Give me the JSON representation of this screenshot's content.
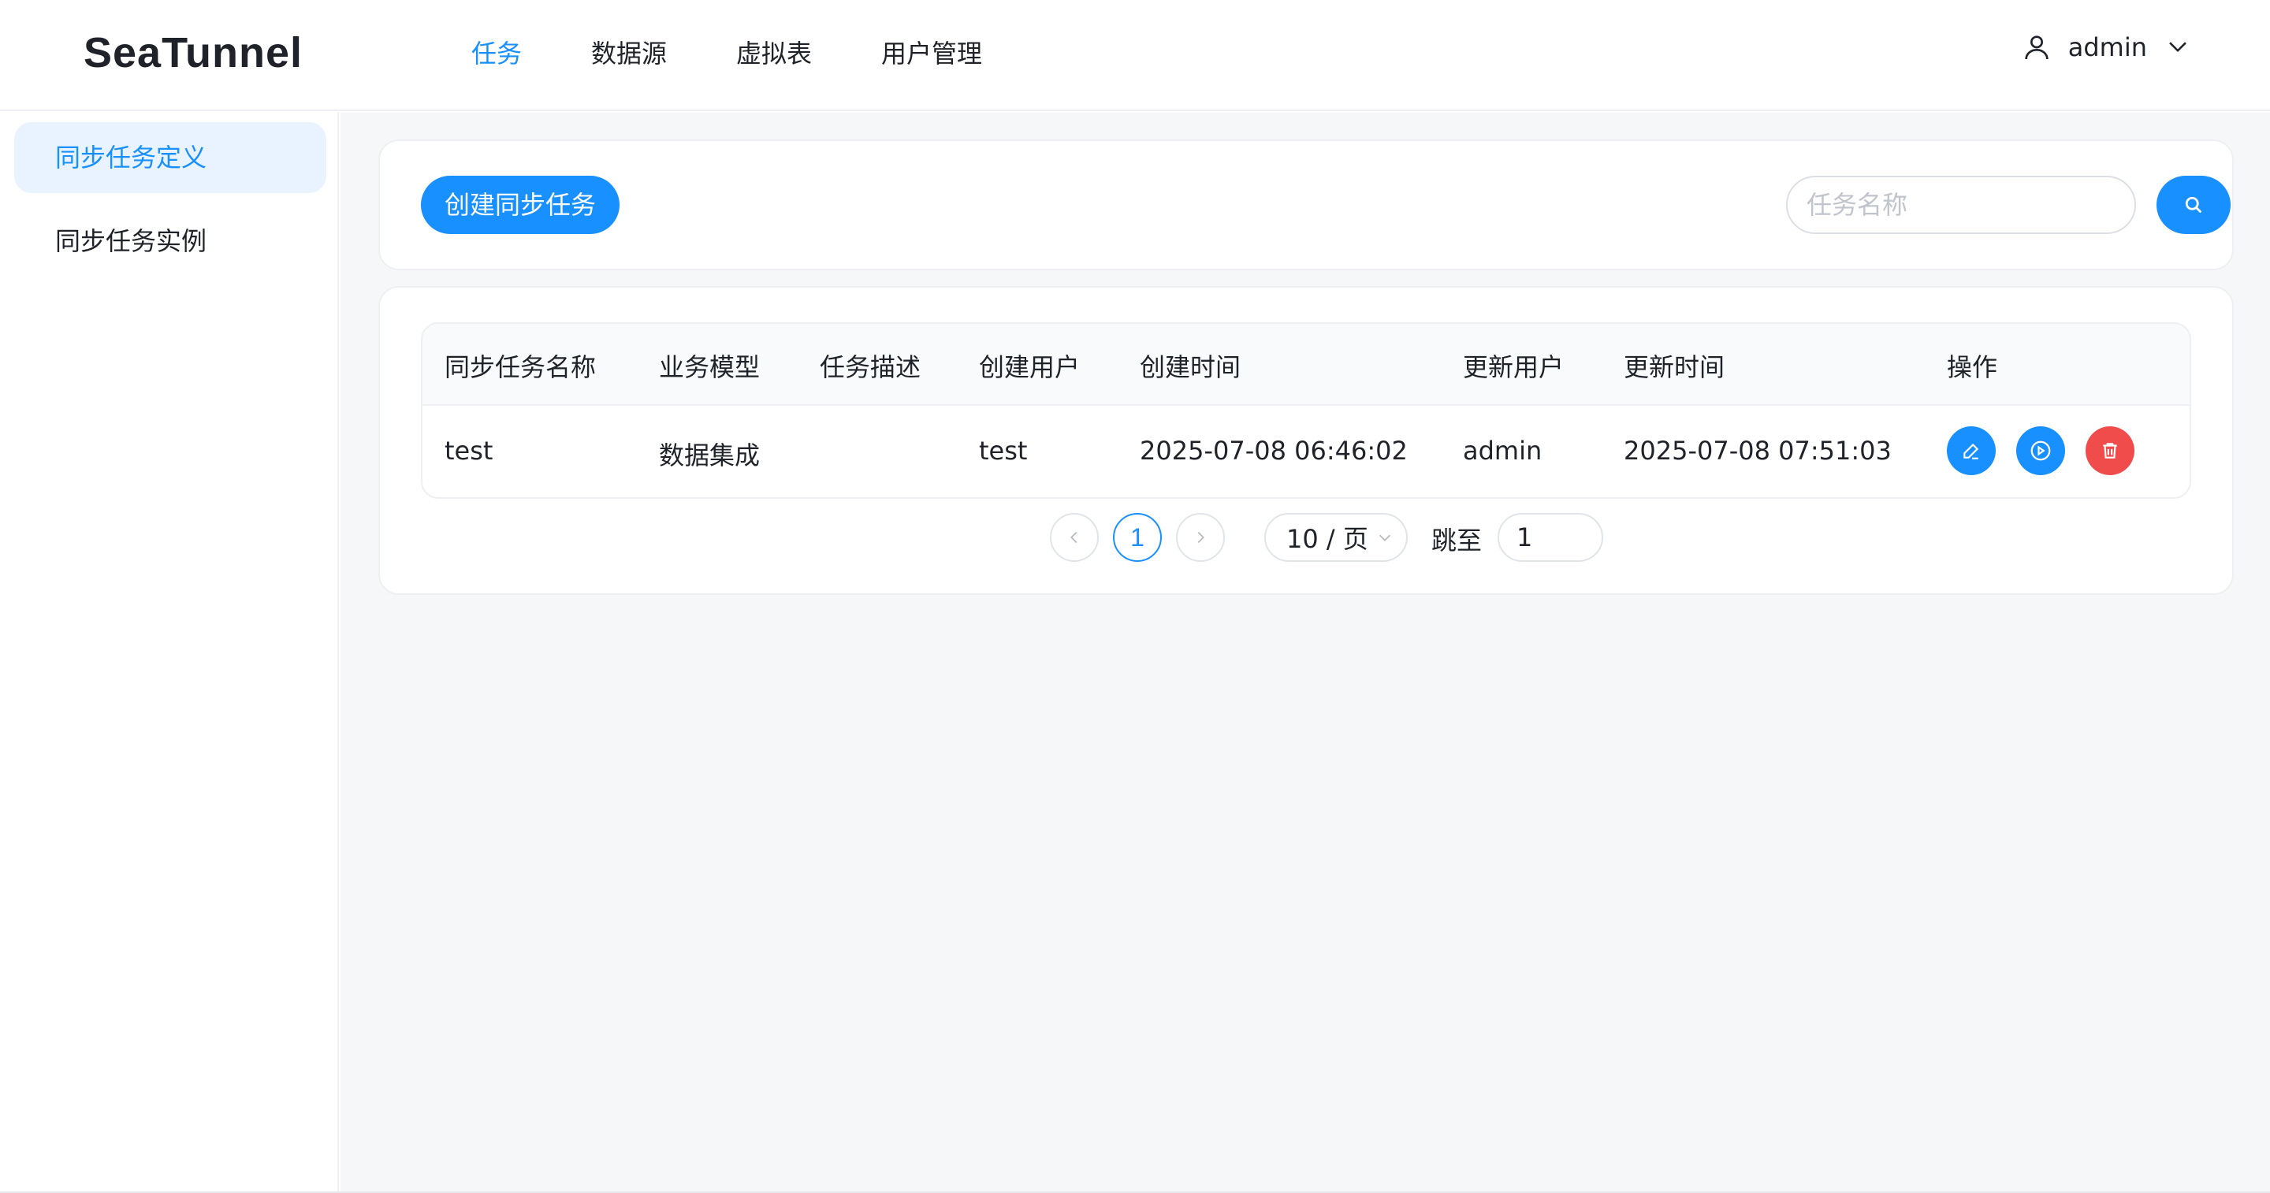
{
  "app": {
    "logo": "SeaTunnel"
  },
  "nav": {
    "items": [
      {
        "label": "任务",
        "active": true
      },
      {
        "label": "数据源",
        "active": false
      },
      {
        "label": "虚拟表",
        "active": false
      },
      {
        "label": "用户管理",
        "active": false
      }
    ]
  },
  "user": {
    "name": "admin",
    "icon": "user-icon",
    "dropdown_icon": "chevron-down-icon"
  },
  "sidebar": {
    "items": [
      {
        "label": "同步任务定义",
        "active": true
      },
      {
        "label": "同步任务实例",
        "active": false
      }
    ]
  },
  "toolbar": {
    "create_label": "创建同步任务",
    "search_placeholder": "任务名称",
    "search_value": "",
    "search_icon": "search-icon"
  },
  "table": {
    "columns": [
      "同步任务名称",
      "业务模型",
      "任务描述",
      "创建用户",
      "创建时间",
      "更新用户",
      "更新时间",
      "操作"
    ],
    "rows": [
      {
        "name": "test",
        "model": "数据集成",
        "description": "",
        "creator": "test",
        "created_at": "2025-07-08 06:46:02",
        "updater": "admin",
        "updated_at": "2025-07-08 07:51:03",
        "actions": [
          "edit-icon",
          "play-icon",
          "delete-icon"
        ]
      }
    ]
  },
  "pagination": {
    "current_page": "1",
    "page_size": "10 / 页",
    "jump_label": "跳至",
    "jump_value": "1"
  },
  "colors": {
    "primary": "#1890ff",
    "danger": "#f04c4c",
    "background": "#f6f7f9",
    "sidebar_active_bg": "#e8f3ff"
  }
}
